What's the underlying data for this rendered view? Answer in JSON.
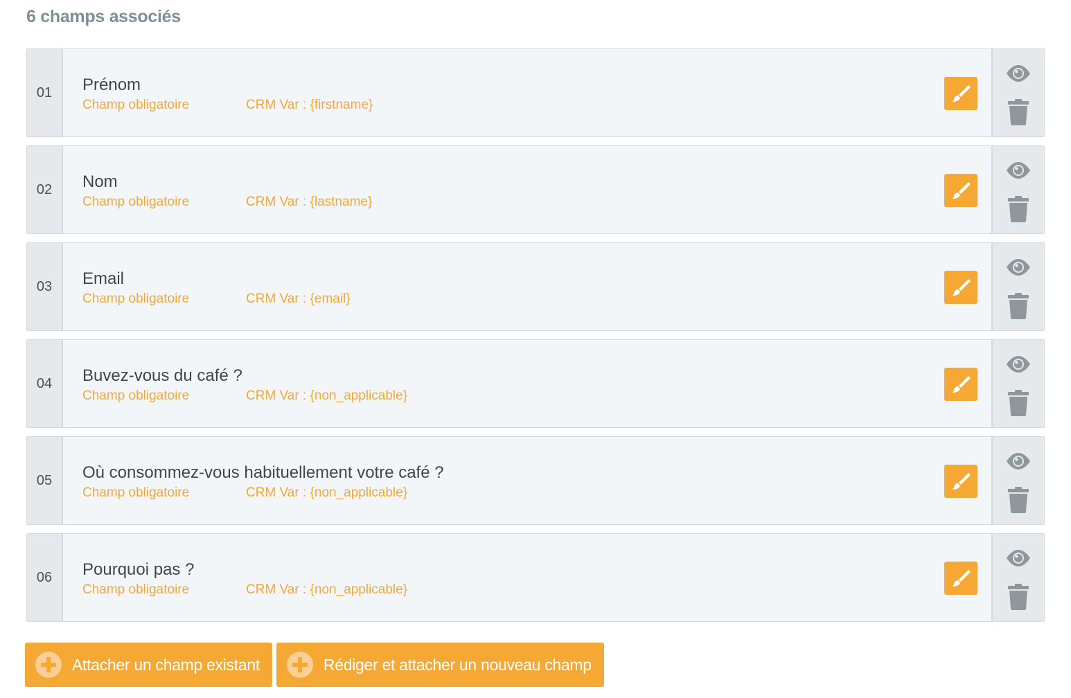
{
  "heading": "6 champs associés",
  "fields": [
    {
      "number": "01",
      "title": "Prénom",
      "required": "Champ obligatoire",
      "crm": "CRM Var : {firstname}"
    },
    {
      "number": "02",
      "title": "Nom",
      "required": "Champ obligatoire",
      "crm": "CRM Var : {lastname}"
    },
    {
      "number": "03",
      "title": "Email",
      "required": "Champ obligatoire",
      "crm": "CRM Var : {email}"
    },
    {
      "number": "04",
      "title": "Buvez-vous du café ?",
      "required": "Champ obligatoire",
      "crm": "CRM Var : {non_applicable}"
    },
    {
      "number": "05",
      "title": "Où consommez-vous habituellement votre café ?",
      "required": "Champ obligatoire",
      "crm": "CRM Var : {non_applicable}"
    },
    {
      "number": "06",
      "title": "Pourquoi pas ?",
      "required": "Champ obligatoire",
      "crm": "CRM Var : {non_applicable}"
    }
  ],
  "buttons": {
    "attach_existing": "Attacher un champ existant",
    "write_new": "Rédiger et attacher un nouveau champ"
  },
  "icons": {
    "edit": "brush-icon",
    "view": "eye-icon",
    "delete": "trash-icon",
    "add": "plus-circle-icon"
  },
  "colors": {
    "accent": "#f5a834",
    "heading": "#7d9098",
    "icon_gray": "#8d979c"
  }
}
